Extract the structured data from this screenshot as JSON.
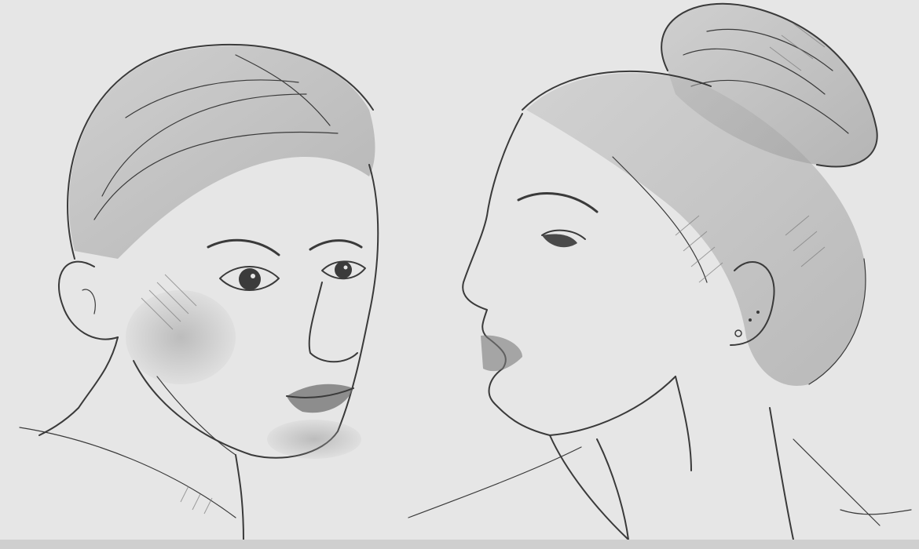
{
  "image": {
    "subject": "",
    "colors": {
      "background": "#e6e6e6",
      "line": "#3a3a3a",
      "shade": "#9a9a9a",
      "bottom_bar": "#cfcfcf"
    }
  }
}
